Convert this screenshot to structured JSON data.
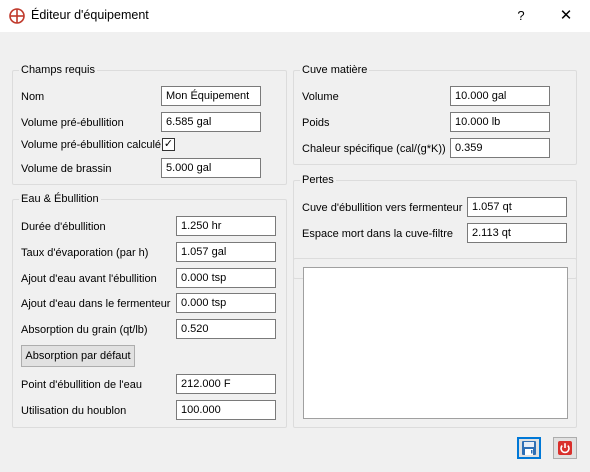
{
  "window": {
    "title": "Éditeur d'équipement",
    "help_label": "?",
    "close_label": "✕"
  },
  "required": {
    "title": "Champs requis",
    "name_label": "Nom",
    "name_value": "Mon Équipement",
    "preboil_label": "Volume pré-ébullition",
    "preboil_value": "6.585 gal",
    "calc_label": "Volume pré-ébullition calculé",
    "calc_checked": "✓",
    "batch_label": "Volume de brassin",
    "batch_value": "5.000 gal"
  },
  "water": {
    "title": "Eau & Ébullition",
    "boil_time_label": "Durée d'ébullition",
    "boil_time_value": "1.250 hr",
    "evap_label": "Taux d'évaporation (par h)",
    "evap_value": "1.057 gal",
    "topup_kettle_label": "Ajout d'eau avant l'ébullition",
    "topup_kettle_value": "0.000 tsp",
    "topup_fermenter_label": "Ajout d'eau dans le fermenteur",
    "topup_fermenter_value": "0.000 tsp",
    "absorption_label": "Absorption du grain (qt/lb)",
    "absorption_value": "0.520",
    "default_absorption_button": "Absorption par défaut",
    "boiling_point_label": "Point d'ébullition de l'eau",
    "boiling_point_value": "212.000 F",
    "hop_util_label": "Utilisation du houblon",
    "hop_util_value": "100.000"
  },
  "mash_tun": {
    "title": "Cuve matière",
    "volume_label": "Volume",
    "volume_value": "10.000 gal",
    "weight_label": "Poids",
    "weight_value": "10.000 lb",
    "specific_heat_label": "Chaleur spécifique (cal/(g*K))",
    "specific_heat_value": "0.359"
  },
  "losses": {
    "title": "Pertes",
    "kettle_to_fermenter_label": "Cuve d'ébullition vers fermenteur",
    "kettle_to_fermenter_value": "1.057 qt",
    "lauter_deadspace_label": "Espace mort dans la cuve-filtre",
    "lauter_deadspace_value": "2.113 qt"
  },
  "notes": {
    "value": ""
  },
  "icons": {
    "app": "brewtarget-icon",
    "save": "save-icon",
    "cancel": "power-icon"
  },
  "colors": {
    "accent": "#0078d7",
    "cancel_red": "#d9302c"
  }
}
